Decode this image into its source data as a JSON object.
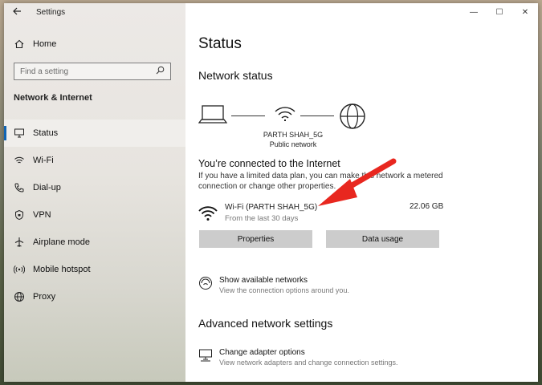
{
  "app": {
    "title": "Settings"
  },
  "window_controls": {
    "minimize": "—",
    "maximize": "☐",
    "close": "✕"
  },
  "sidebar": {
    "home_label": "Home",
    "search_placeholder": "Find a setting",
    "section_label": "Network & Internet",
    "items": [
      {
        "label": "Status",
        "icon": "status-icon",
        "active": true
      },
      {
        "label": "Wi-Fi",
        "icon": "wifi-icon"
      },
      {
        "label": "Dial-up",
        "icon": "phone-icon"
      },
      {
        "label": "VPN",
        "icon": "vpn-icon"
      },
      {
        "label": "Airplane mode",
        "icon": "airplane-icon"
      },
      {
        "label": "Mobile hotspot",
        "icon": "hotspot-icon"
      },
      {
        "label": "Proxy",
        "icon": "globe-icon"
      }
    ]
  },
  "main": {
    "page_title": "Status",
    "network_status_heading": "Network status",
    "network": {
      "name": "PARTH SHAH_5G",
      "type": "Public network"
    },
    "connected_title": "You’re connected to the Internet",
    "connected_desc": "If you have a limited data plan, you can make this network a metered connection or change other properties.",
    "connection": {
      "name": "Wi-Fi (PARTH SHAH_5G)",
      "period": "From the last 30 days",
      "usage": "22.06 GB"
    },
    "buttons": {
      "properties": "Properties",
      "data_usage": "Data usage"
    },
    "show_networks": {
      "title": "Show available networks",
      "desc": "View the connection options around you."
    },
    "advanced_heading": "Advanced network settings",
    "change_adapter": {
      "title": "Change adapter options",
      "desc": "View network adapters and change connection settings."
    }
  },
  "colors": {
    "accent": "#0f64b4",
    "annotation_arrow": "#e8271f",
    "button_bg": "#cccccc"
  }
}
